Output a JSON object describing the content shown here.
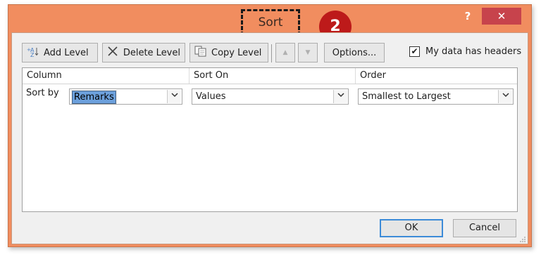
{
  "window": {
    "title": "Sort",
    "help_label": "?",
    "close_label": "✕"
  },
  "annotation": {
    "badge_number": "2"
  },
  "toolbar": {
    "add_level": "Add Level",
    "delete_level": "Delete Level",
    "copy_level": "Copy Level",
    "move_up_glyph": "▲",
    "move_down_glyph": "▼",
    "options": "Options...",
    "headers_label": "My data has headers",
    "headers_checked": "✔"
  },
  "grid": {
    "columns": [
      "Column",
      "Sort On",
      "Order"
    ],
    "rows": [
      {
        "label": "Sort by",
        "column_value": "Remarks",
        "sort_on_value": "Values",
        "order_value": "Smallest to Largest"
      }
    ]
  },
  "buttons": {
    "ok": "OK",
    "cancel": "Cancel"
  },
  "icons": {
    "add": "add-level-icon",
    "delete": "delete-level-icon",
    "copy": "copy-level-icon",
    "dropdown": "chevron-down-icon"
  },
  "colors": {
    "title_bar": "#f18d5f",
    "close_button": "#c7434c",
    "badge": "#bd1a1a",
    "selection": "#6ca0dc"
  }
}
